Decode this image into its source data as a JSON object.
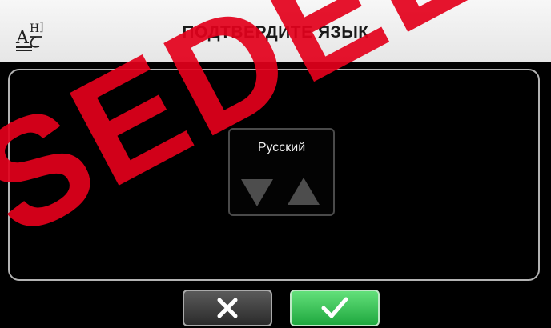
{
  "header": {
    "title": "ПОДТВЕРДИТЕ ЯЗЫК",
    "icon": "language-icon"
  },
  "language_selector": {
    "selected": "Русский",
    "down_icon": "arrow-down-icon",
    "up_icon": "arrow-up-icon"
  },
  "actions": {
    "cancel_icon": "close-icon",
    "confirm_icon": "checkmark-icon"
  },
  "watermark": "SEDEE",
  "colors": {
    "header_bg": "#eeeeee",
    "confirm_green": "#2bbf4d",
    "cancel_gray": "#3a3a3a",
    "watermark_red": "#e3001b"
  }
}
